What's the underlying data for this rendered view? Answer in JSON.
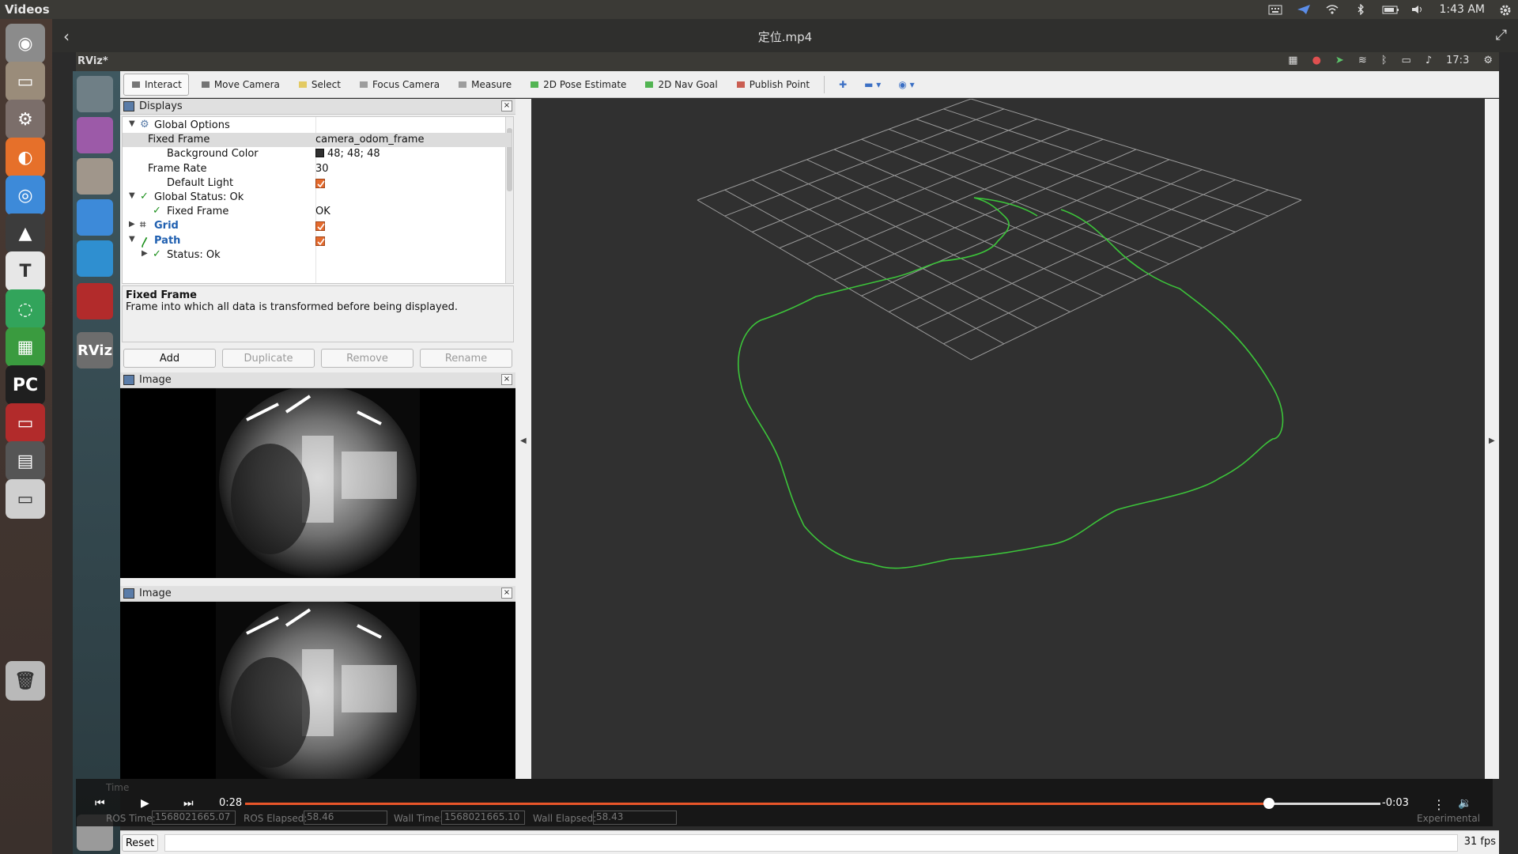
{
  "top_panel": {
    "app_title": "Videos",
    "clock": "1:43 AM",
    "icons": [
      "keyboard-icon",
      "telegram-icon",
      "wifi-icon",
      "bluetooth-icon",
      "battery-icon",
      "volume-icon",
      "gear-icon"
    ]
  },
  "video": {
    "title": "定位.mp4",
    "back_glyph": "‹",
    "expand_glyph": "⤢",
    "elapsed": "0:28",
    "remaining": "-0:03",
    "progress": 0.902
  },
  "launcher": {
    "items": [
      {
        "name": "ubuntu-dash-icon",
        "color": "#8b8b8b",
        "glyph": "◉"
      },
      {
        "name": "files-icon",
        "color": "#9a8c7a",
        "glyph": "▭"
      },
      {
        "name": "settings-icon",
        "color": "#7b6e6a",
        "glyph": "⚙"
      },
      {
        "name": "firefox-icon",
        "color": "#e6702a",
        "glyph": "◐"
      },
      {
        "name": "chrome-icon",
        "color": "#3d8ad9",
        "glyph": "◎"
      },
      {
        "name": "inkscape-icon",
        "color": "#3c3c3c",
        "glyph": "▲"
      },
      {
        "name": "typora-icon",
        "color": "#e7e7e7",
        "glyph": "T"
      },
      {
        "name": "refresh-app-icon",
        "color": "#32a45b",
        "glyph": "◌"
      },
      {
        "name": "spreadsheet-icon",
        "color": "#3a9b3f",
        "glyph": "▦"
      },
      {
        "name": "pycharm-icon",
        "color": "#1f1f1f",
        "glyph": "PC"
      },
      {
        "name": "terminal-app-icon",
        "color": "#b22b2b",
        "glyph": "▭"
      },
      {
        "name": "video-player-icon",
        "color": "#555555",
        "glyph": "▤"
      },
      {
        "name": "disk-icon",
        "color": "#cfcfcf",
        "glyph": "▭"
      },
      {
        "name": "trash-icon",
        "color": "#b9b9b9",
        "glyph": "🗑"
      }
    ]
  },
  "rviz": {
    "window_title": "RViz*",
    "clock": "17:3",
    "toolbar": [
      {
        "name": "interact-tool",
        "label": "Interact",
        "active": true
      },
      {
        "name": "move-camera-tool",
        "label": "Move Camera"
      },
      {
        "name": "select-tool",
        "label": "Select"
      },
      {
        "name": "focus-camera-tool",
        "label": "Focus Camera"
      },
      {
        "name": "measure-tool",
        "label": "Measure"
      },
      {
        "name": "pose-estimate-tool",
        "label": "2D Pose Estimate"
      },
      {
        "name": "nav-goal-tool",
        "label": "2D Nav Goal"
      },
      {
        "name": "publish-point-tool",
        "label": "Publish Point"
      }
    ],
    "displays_title": "Displays",
    "tree": [
      {
        "indent": 0,
        "arrow": "▼",
        "label": "Global Options",
        "value": "",
        "kind": "gear"
      },
      {
        "indent": 1,
        "label": "Fixed Frame",
        "value": "camera_odom_frame",
        "selected": true
      },
      {
        "indent": 1,
        "label": "Background Color",
        "value": "48; 48; 48",
        "kind": "swatch"
      },
      {
        "indent": 1,
        "label": "Frame Rate",
        "value": "30"
      },
      {
        "indent": 1,
        "label": "Default Light",
        "value": "",
        "kind": "checkbox"
      },
      {
        "indent": 0,
        "arrow": "▼",
        "label": "Global Status: Ok",
        "value": "",
        "kind": "check"
      },
      {
        "indent": 1,
        "label": "Fixed Frame",
        "value": "OK",
        "kind": "check"
      },
      {
        "indent": 0,
        "arrow": "▶",
        "label": "Grid",
        "value": "",
        "kind": "grid",
        "blue": true,
        "checkbox": true
      },
      {
        "indent": 0,
        "arrow": "▼",
        "label": "Path",
        "value": "",
        "kind": "path",
        "blue": true,
        "checkbox": true
      },
      {
        "indent": 1,
        "arrow": "▶",
        "label": "Status: Ok",
        "value": "",
        "kind": "check"
      }
    ],
    "desc_title": "Fixed Frame",
    "desc_text": "Frame into which all data is transformed before being displayed.",
    "buttons": {
      "add": "Add",
      "duplicate": "Duplicate",
      "remove": "Remove",
      "rename": "Rename"
    },
    "image_panel_1": "Image",
    "image_panel_2": "Image",
    "time_panel": {
      "title": "Time",
      "ros_time_label": "ROS Time:",
      "ros_time": "1568021665.07",
      "ros_elapsed_label": "ROS Elapsed:",
      "ros_elapsed": "58.46",
      "wall_time_label": "Wall Time:",
      "wall_time": "1568021665.10",
      "wall_elapsed_label": "Wall Elapsed:",
      "wall_elapsed": "58.43",
      "experimental": "Experimental"
    },
    "reset": "Reset",
    "fps": "31 fps"
  },
  "colors": {
    "path": "#3cc43a",
    "grid": "#9a9a9a",
    "background": "#303030",
    "progress": "#e9562a"
  }
}
